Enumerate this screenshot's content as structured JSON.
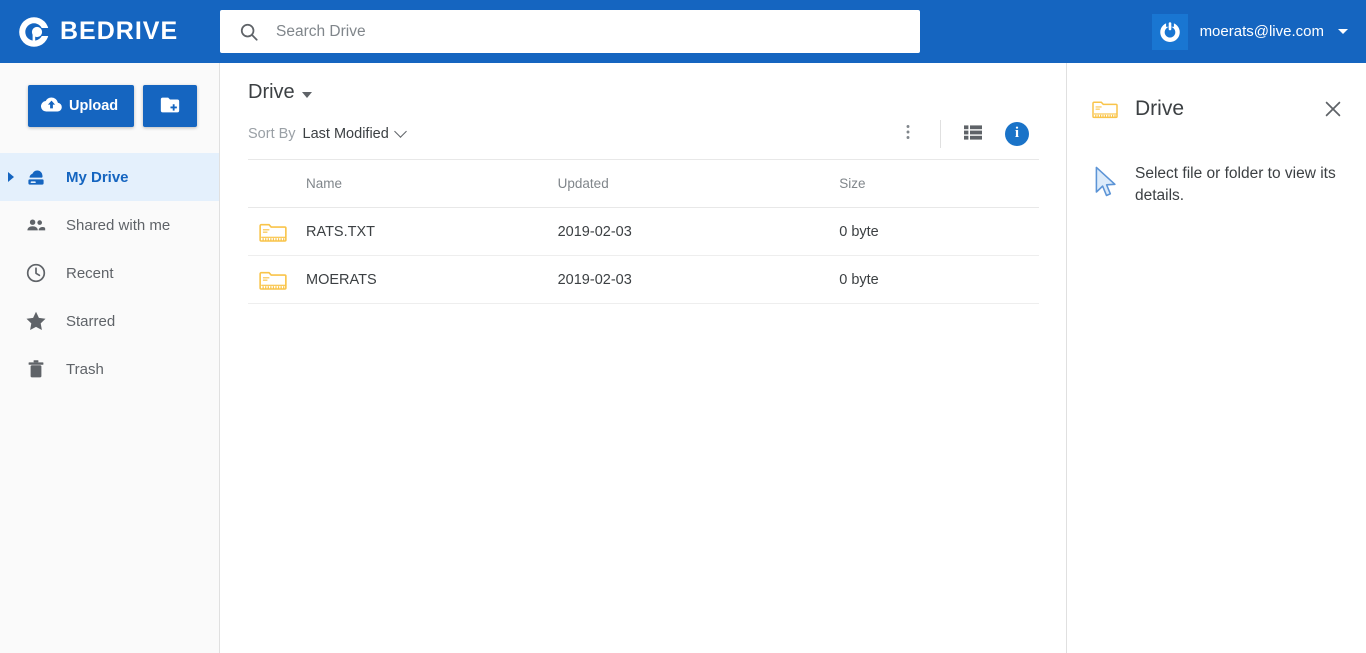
{
  "brand": {
    "name": "BEDRIVE",
    "logo_icon": "bedrive-c-logo"
  },
  "search": {
    "placeholder": "Search Drive",
    "value": "",
    "icon": "search-icon"
  },
  "user": {
    "email": "moerats@live.com",
    "avatar_icon": "power-icon",
    "caret_icon": "caret-down-icon"
  },
  "sidebar": {
    "upload_label": "Upload",
    "upload_icon": "cloud-upload-icon",
    "new_folder_icon": "folder-plus-icon",
    "items": [
      {
        "label": "My Drive",
        "icon": "cloud-drive-icon",
        "active": true
      },
      {
        "label": "Shared with me",
        "icon": "people-icon",
        "active": false
      },
      {
        "label": "Recent",
        "icon": "clock-icon",
        "active": false
      },
      {
        "label": "Starred",
        "icon": "star-icon",
        "active": false
      },
      {
        "label": "Trash",
        "icon": "trash-icon",
        "active": false
      }
    ]
  },
  "main": {
    "breadcrumb": "Drive",
    "sort": {
      "label": "Sort By",
      "value": "Last Modified"
    },
    "toolbar": {
      "more_icon": "dots-vertical-icon",
      "view_icon": "list-view-icon",
      "info_icon": "info-icon",
      "info_glyph": "i"
    },
    "table": {
      "columns": [
        "Name",
        "Updated",
        "Size"
      ],
      "rows": [
        {
          "icon": "folder-icon",
          "name": "RATS.TXT",
          "updated": "2019-02-03",
          "size": "0 byte"
        },
        {
          "icon": "folder-icon",
          "name": "MOERATS",
          "updated": "2019-02-03",
          "size": "0 byte"
        }
      ]
    }
  },
  "details": {
    "title": "Drive",
    "icon": "folder-icon",
    "close_icon": "close-icon",
    "cursor_icon": "cursor-arrow-icon",
    "message": "Select file or folder to view its details."
  },
  "colors": {
    "header_blue": "#1565C0",
    "accent_blue": "#1A73C8",
    "active_nav_bg": "#E4F0FC",
    "folder_yellow": "#F9C449",
    "sidebar_bg": "#FAFAFA",
    "text_primary": "#3C4043",
    "text_muted": "#80868B"
  }
}
